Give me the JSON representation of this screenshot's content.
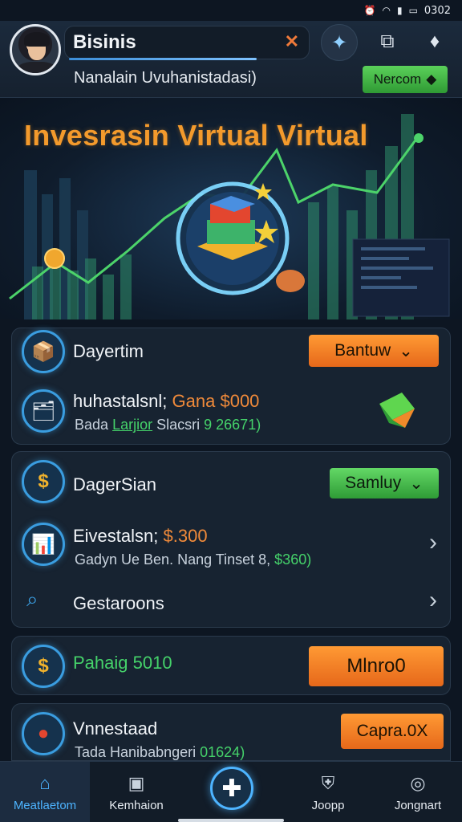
{
  "status_bar": {
    "time": "0302",
    "icons": [
      "alarm-icon",
      "wifi-icon",
      "signal-icon",
      "battery-icon"
    ]
  },
  "header": {
    "brand": "Bisinis",
    "subtitle": "Nanalain Uvuhanistadasi)",
    "next_button": "Nercom",
    "next_icon": "◆"
  },
  "hero": {
    "title": "Invesrasin Virtual Virtual"
  },
  "card1": {
    "row1": {
      "label": "Dayertim",
      "button": "Bantuw"
    },
    "row2": {
      "label_a": "huhastalsnl;",
      "label_b": "Gana $000",
      "sub_a": "Bada",
      "sub_b": "Larjior",
      "sub_c": "Slacsri",
      "sub_d": "9 26671)"
    }
  },
  "card2": {
    "row1": {
      "label": "DagerSian",
      "button": "Samluy"
    },
    "row2": {
      "label_a": "Eivestalsn;",
      "label_b": "$.300",
      "sub_a": "Gadyn Ue Ben. Nang Tinset 8,",
      "sub_b": "$360)"
    },
    "row3": {
      "label": "Gestaroons"
    }
  },
  "card3": {
    "label": "Pahaig 5010",
    "button": "Mlnro0"
  },
  "card4": {
    "label": "Vnnestaad",
    "sub_a": "Tada Hanibabngeri",
    "sub_b": "01624)",
    "button": "Capra.0X"
  },
  "bottom_nav": {
    "items": [
      {
        "label": "Meatlaetom",
        "icon": "home-icon",
        "active": true
      },
      {
        "label": "Kemhaion",
        "icon": "wallet-icon",
        "active": false
      },
      {
        "label": "",
        "icon": "plus-icon",
        "active": false
      },
      {
        "label": "Joopp",
        "icon": "shield-icon",
        "active": false
      },
      {
        "label": "Jongnart",
        "icon": "target-icon",
        "active": false
      }
    ]
  },
  "colors": {
    "accent_orange": "#f39a2c",
    "accent_green": "#45d26a",
    "accent_blue": "#4db4ff",
    "background": "#0d1622",
    "card": "#172331"
  }
}
